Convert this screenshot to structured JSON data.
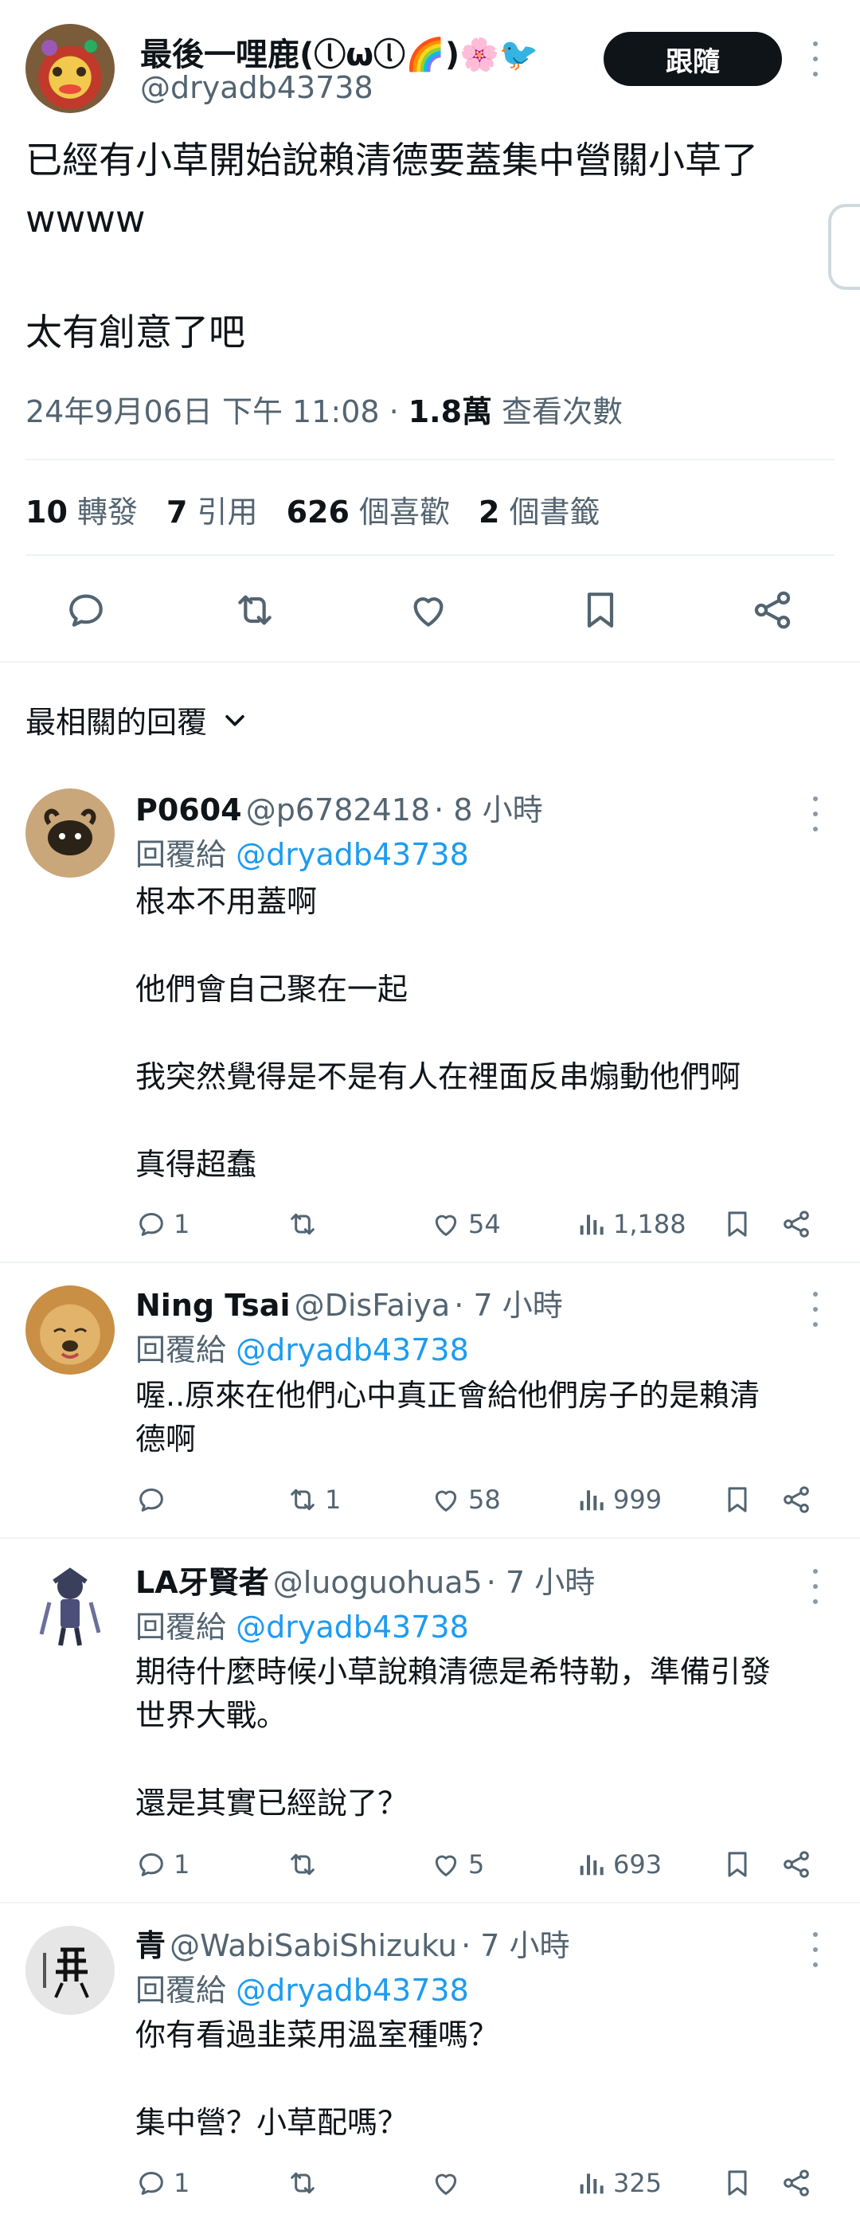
{
  "header": {
    "display_name": "最後一哩鹿(ⓛωⓛ🌈)🌸🐦",
    "handle": "@dryadb43738",
    "follow_label": "跟隨"
  },
  "tweet": {
    "line1": "已經有小草開始說賴清德要蓋集中營關小草了",
    "line2": "wwww",
    "line3": "太有創意了吧",
    "timestamp": "24年9月06日 下午 11:08 ·",
    "views_count": "1.8萬",
    "views_label": "查看次數"
  },
  "stats": {
    "reposts_count": "10",
    "reposts_label": "轉發",
    "quotes_count": "7",
    "quotes_label": "引用",
    "likes_count": "626",
    "likes_label": "個喜歡",
    "bookmarks_count": "2",
    "bookmarks_label": "個書籤"
  },
  "sort": {
    "label": "最相關的回覆"
  },
  "replies": [
    {
      "name": "P0604",
      "handle": "@p6782418",
      "time": "· 8 小時",
      "reply_to_label": "回覆給",
      "reply_to_handle": "@dryadb43738",
      "body": "根本不用蓋啊\n\n他們會自己聚在一起\n\n我突然覺得是不是有人在裡面反串煽動他們啊\n\n真得超蠢",
      "replies": "1",
      "reposts": "",
      "likes": "54",
      "views": "1,188"
    },
    {
      "name": "Ning Tsai",
      "handle": "@DisFaiya",
      "time": "· 7 小時",
      "reply_to_label": "回覆給",
      "reply_to_handle": "@dryadb43738",
      "body": "喔..原來在他們心中真正會給他們房子的是賴清\n德啊",
      "replies": "",
      "reposts": "1",
      "likes": "58",
      "views": "999"
    },
    {
      "name": "LA牙賢者",
      "handle": "@luoguohua5",
      "time": "· 7 小時",
      "reply_to_label": "回覆給",
      "reply_to_handle": "@dryadb43738",
      "body": "期待什麼時候小草說賴清德是希特勒，準備引發\n世界大戰。\n\n還是其實已經說了？",
      "replies": "1",
      "reposts": "",
      "likes": "5",
      "views": "693"
    },
    {
      "name": "青",
      "handle": "@WabiSabiShizuku",
      "time": "· 7 小時",
      "reply_to_label": "回覆給",
      "reply_to_handle": "@dryadb43738",
      "body": "你有看過韭菜用溫室種嗎？\n\n集中營？小草配嗎？",
      "replies": "1",
      "reposts": "",
      "likes": "",
      "views": "325"
    }
  ],
  "colors": {
    "accent": "#1d9bf0",
    "muted": "#536471",
    "follow_bg": "#0f1419"
  }
}
